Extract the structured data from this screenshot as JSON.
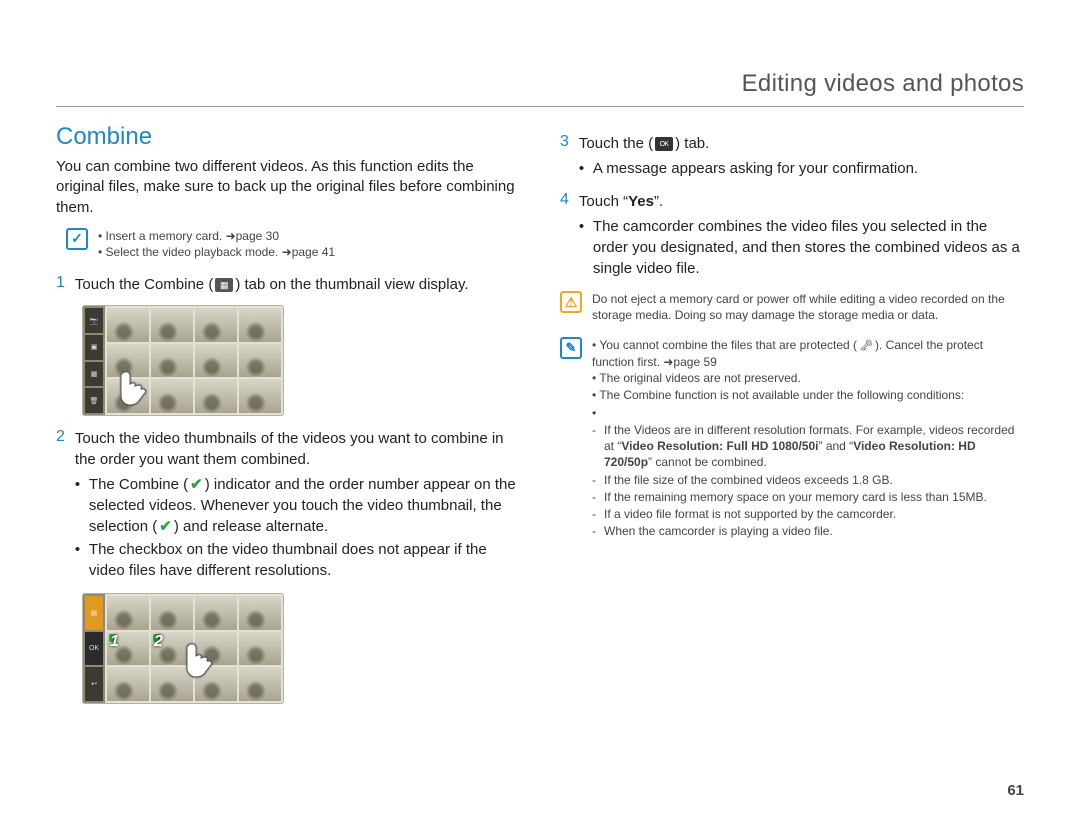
{
  "header_title": "Editing videos and photos",
  "section_title": "Combine",
  "intro": "You can combine two different videos. As this function edits the original files, make sure to back up the original files before combining them.",
  "prereq_items": [
    "Insert a memory card. ➜page 30",
    "Select the video playback mode. ➜page 41"
  ],
  "step1_pre": "Touch the Combine (",
  "step1_post": ") tab on the thumbnail view display.",
  "step2_main": "Touch the video thumbnails of the videos you want to combine in the order you want them combined.",
  "step2_b1_pre": "The Combine (",
  "step2_b1_mid": ") indicator and the order number appear on the selected videos. Whenever you touch the video thumbnail, the selection (",
  "step2_b1_post": ") and release alternate.",
  "step2_b2": "The checkbox on the video thumbnail does not appear if the video files have different resolutions.",
  "step3_pre": "Touch the (",
  "step3_post": ") tab.",
  "step3_sub": "A message appears asking for your confirmation.",
  "step4_pre": "Touch “",
  "step4_bold": "Yes",
  "step4_post": "”.",
  "step4_sub": "The camcorder combines the video files you selected in the order you designated, and then stores the combined videos as a single video file.",
  "warning_text": "Do not eject a memory card or power off while editing a video recorded on the storage media. Doing so may damage the storage media or data.",
  "note_b1_pre": "You cannot combine the files that are protected (",
  "note_b1_post": "). Cancel the protect function first. ➜page 59",
  "note_b2": "The original videos are not preserved.",
  "note_b3": "The Combine function is not available under the following conditions:",
  "note_b3_s1_pre": "If the Videos are in different resolution formats. For example, videos recorded at “",
  "note_b3_s1_bold1": "Video Resolution: Full HD  1080/50i",
  "note_b3_s1_mid": "” and “",
  "note_b3_s1_bold2": "Video Resolution: HD  720/50p",
  "note_b3_s1_post": "” cannot be combined.",
  "note_b3_s2": "If the file size of the combined videos exceeds 1.8 GB.",
  "note_b3_s3": "If the remaining memory space on your memory card is less than 15MB.",
  "note_b3_s4": "If a video file format is not supported by the camcorder.",
  "note_b3_s5": "When the camcorder is playing a video file.",
  "ok_label": "OK",
  "page_number": "61"
}
